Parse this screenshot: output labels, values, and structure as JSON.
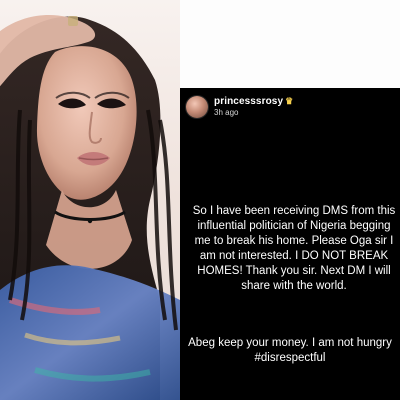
{
  "story": {
    "username": "princesssrosy",
    "timestamp": "3h ago",
    "icons": {
      "crown": "crown-icon"
    },
    "message_lines": [
      "So I have been receiving DMS from this",
      "influential politician of Nigeria begging",
      "me to break his home. Please Oga sir I",
      "am not interested. I DO NOT BREAK",
      "HOMES! Thank you sir. Next DM I will",
      "share with the world."
    ],
    "message2_lines": [
      "Abeg keep your money. I am not hungry",
      "#disrespectful"
    ]
  },
  "colors": {
    "story_bg": "#000000",
    "story_text": "#ffffff",
    "crown": "#f7d04d"
  }
}
